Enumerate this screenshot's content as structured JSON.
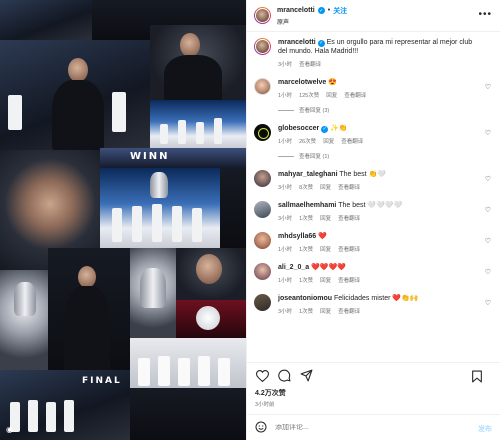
{
  "post": {
    "username": "mrancelotti",
    "follow_label": "关注",
    "subtitle": "原声",
    "more_label": "•••"
  },
  "caption": {
    "username": "mrancelotti",
    "text": "Es un orgullo para mi representar al mejor club del mundo. Hala Madrid!!!",
    "time": "3小时",
    "translate": "查看翻译"
  },
  "comments": [
    {
      "username": "marcelotwelve",
      "text": "😍",
      "time": "1小时",
      "likes": "125次赞",
      "reply": "回复",
      "translate": "查看翻译",
      "replies_label": "查看回复 (3)"
    },
    {
      "username": "globesoccer",
      "text": "✨👏",
      "time": "1小时",
      "likes": "26次赞",
      "reply": "回复",
      "translate": "查看翻译",
      "replies_label": "查看回复 (1)"
    },
    {
      "username": "mahyar_taleghani",
      "text": "The best 👏🤍",
      "time": "3小时",
      "likes": "8次赞",
      "reply": "回复",
      "translate": "查看翻译"
    },
    {
      "username": "sallmaelhemhami",
      "text": "The best 🤍🤍🤍🤍",
      "time": "3小时",
      "likes": "1次赞",
      "reply": "回复",
      "translate": "查看翻译"
    },
    {
      "username": "mhdsylla66",
      "text": "❤️",
      "time": "1小时",
      "likes": "1次赞",
      "reply": "回复",
      "translate": "查看翻译"
    },
    {
      "username": "ali_2_0_a",
      "text": "❤️❤️❤️❤️",
      "time": "1小时",
      "likes": "1次赞",
      "reply": "回复",
      "translate": "查看翻译"
    },
    {
      "username": "joseantoniomou",
      "text": "Felicidades mister ❤️👏🙌",
      "time": "3小时",
      "likes": "1次赞",
      "reply": "回复",
      "translate": "查看翻译"
    }
  ],
  "footer": {
    "likes": "4.2万次赞",
    "time": "3小时前",
    "comment_placeholder": "添加评论...",
    "post_label": "发布"
  },
  "media": {
    "overlay_winners": "WINN",
    "overlay_final": "FINAL"
  },
  "icons": [
    "heart-icon",
    "comment-icon",
    "share-icon",
    "bookmark-icon",
    "emoji-icon",
    "verified-icon",
    "more-icon"
  ],
  "colors": {
    "accent": "#0095f6",
    "verified": "#0095f6",
    "muted": "#737373"
  }
}
